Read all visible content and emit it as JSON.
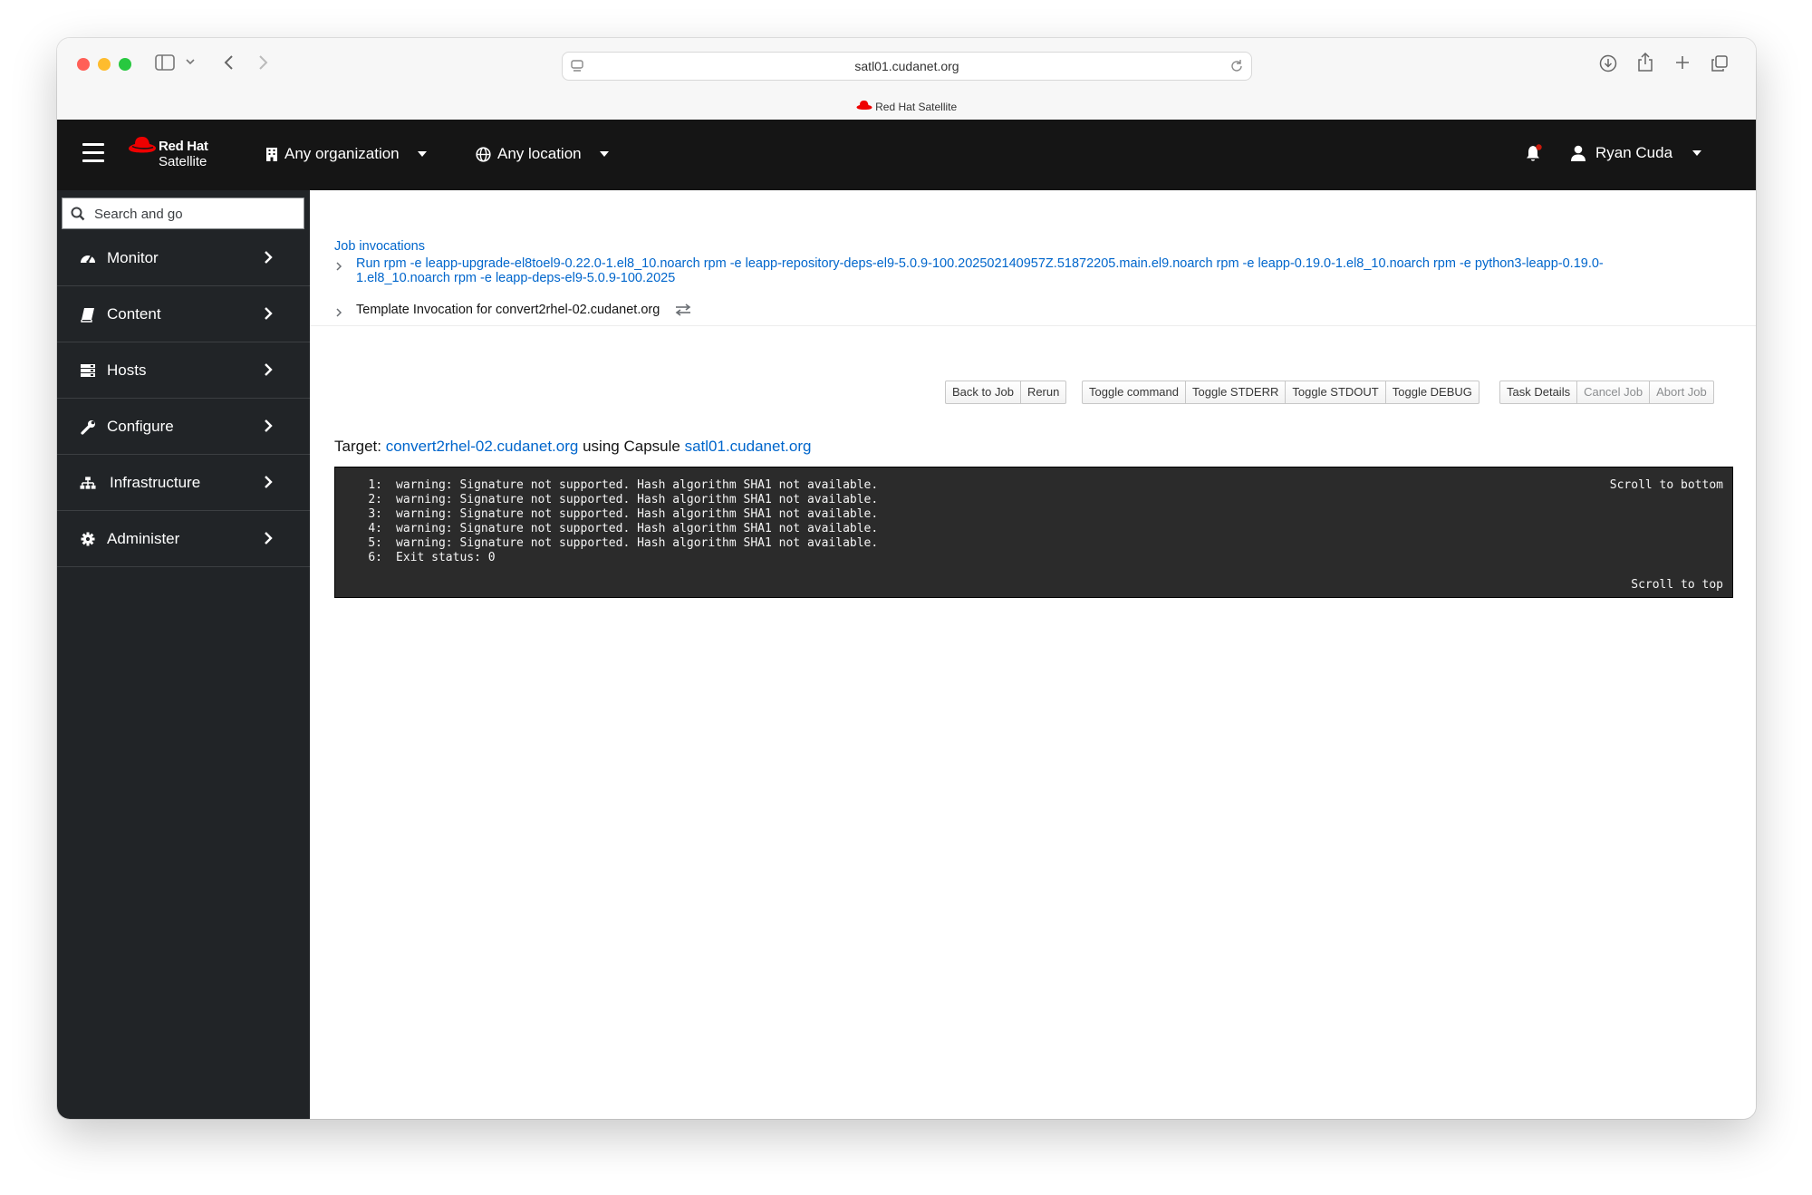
{
  "browser": {
    "url": "satl01.cudanet.org",
    "tab_title": "Red Hat Satellite"
  },
  "header": {
    "brand_line1": "Red Hat",
    "brand_line2": "Satellite",
    "organization": "Any organization",
    "location": "Any location",
    "user_name": "Ryan Cuda"
  },
  "sidebar": {
    "search_placeholder": "Search and go",
    "items": [
      {
        "label": "Monitor",
        "icon": "tachometer-icon"
      },
      {
        "label": "Content",
        "icon": "book-icon"
      },
      {
        "label": "Hosts",
        "icon": "server-icon"
      },
      {
        "label": "Configure",
        "icon": "wrench-icon"
      },
      {
        "label": "Infrastructure",
        "icon": "sitemap-icon"
      },
      {
        "label": "Administer",
        "icon": "gear-icon"
      }
    ]
  },
  "breadcrumb": {
    "root": "Job invocations",
    "job_line1": "Run rpm -e leapp-upgrade-el8toel9-0.22.0-1.el8_10.noarch rpm -e leapp-repository-deps-el9-5.0.9-100.202502140957Z.51872205.main.el9.noarch rpm -e leapp-0.19.0-1.el8_10.noarch rpm -e python3-leapp-0.19.0-",
    "job_line2": "1.el8_10.noarch rpm -e leapp-deps-el9-5.0.9-100.2025",
    "current": "Template Invocation for convert2rhel-02.cudanet.org"
  },
  "toolbar": {
    "back_to_job": "Back to Job",
    "rerun": "Rerun",
    "toggle_command": "Toggle command",
    "toggle_stderr": "Toggle STDERR",
    "toggle_stdout": "Toggle STDOUT",
    "toggle_debug": "Toggle DEBUG",
    "task_details": "Task Details",
    "cancel_job": "Cancel Job",
    "abort_job": "Abort Job"
  },
  "target": {
    "prefix": "Target:",
    "host": "convert2rhel-02.cudanet.org",
    "middle": "using Capsule",
    "capsule": "satl01.cudanet.org"
  },
  "console": {
    "scroll_bottom": "Scroll to bottom",
    "scroll_top": "Scroll to top",
    "lines": [
      {
        "num": "1:",
        "text": "warning: Signature not supported. Hash algorithm SHA1 not available."
      },
      {
        "num": "2:",
        "text": "warning: Signature not supported. Hash algorithm SHA1 not available."
      },
      {
        "num": "3:",
        "text": "warning: Signature not supported. Hash algorithm SHA1 not available."
      },
      {
        "num": "4:",
        "text": "warning: Signature not supported. Hash algorithm SHA1 not available."
      },
      {
        "num": "5:",
        "text": "warning: Signature not supported. Hash algorithm SHA1 not available."
      },
      {
        "num": "6:",
        "text": "Exit status: 0"
      }
    ]
  },
  "colors": {
    "link": "#0066cc",
    "masthead": "#151515",
    "sidebar": "#212427",
    "brand_red": "#ee0000",
    "console_bg": "#2b2b2b"
  }
}
